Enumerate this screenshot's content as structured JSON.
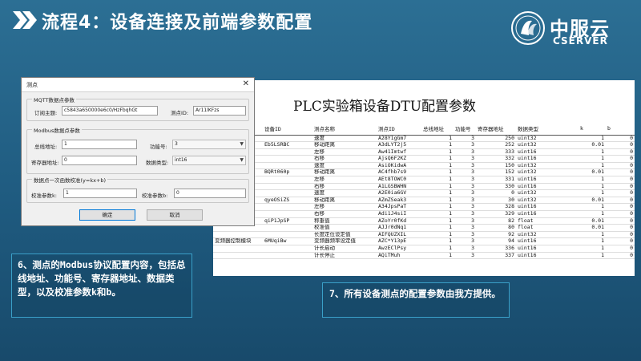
{
  "slide": {
    "title": "流程4：设备连接及前端参数配置",
    "logo_cn": "中服云",
    "logo_en": "CSERVER"
  },
  "dialog": {
    "title": "测点",
    "close_glyph": "✕",
    "mqtt_group": "MQTT数据点参数",
    "topic_label": "订阅主题:",
    "topic_value": "c5843a650000e6c0/HzFbqhGt",
    "point_id_label": "测点ID:",
    "point_id_value": "Ar11lKFzs",
    "modbus_group": "Modbus数据点参数",
    "bus_addr_label": "总线地址:",
    "bus_addr_value": "1",
    "func_label": "功能号:",
    "func_value": "3",
    "reg_addr_label": "寄存器地址:",
    "reg_addr_value": "0",
    "dtype_label": "数据类型:",
    "dtype_value": "int16",
    "calib_group": "数据点一次函数校准(y=kx+b)",
    "k_label": "校准参数k:",
    "k_value": "1",
    "b_label": "校准参数b:",
    "b_value": "0",
    "ok_label": "确定",
    "cancel_label": "取消"
  },
  "sheet": {
    "title": "PLC实验箱设备DTU配置参数",
    "headers": [
      "",
      "设备ID",
      "测点名称",
      "测点ID",
      "总线地址",
      "功能号",
      "寄存器地址",
      "数据类型",
      "k",
      "b"
    ],
    "rows": [
      [
        "",
        "",
        "速度",
        "A28Y1gGm7",
        "1",
        "3",
        "250",
        "uint32",
        "1",
        "0"
      ],
      [
        "机",
        "Eb5LSRBC",
        "移动距离",
        "A3dLYT2j5",
        "1",
        "3",
        "252",
        "uint32",
        "0.01",
        "0"
      ],
      [
        "",
        "",
        "左移",
        "Aw41Imtwf",
        "1",
        "3",
        "333",
        "uint16",
        "1",
        "0"
      ],
      [
        "",
        "",
        "右移",
        "AjsQ6F2KZ",
        "1",
        "3",
        "332",
        "uint16",
        "1",
        "0"
      ],
      [
        "",
        "",
        "速度",
        "AsiOKidwA",
        "1",
        "3",
        "150",
        "uint32",
        "1",
        "0"
      ],
      [
        "",
        "BQRt060p",
        "移动距离",
        "AC4fhb7s9",
        "1",
        "3",
        "152",
        "uint32",
        "0.01",
        "0"
      ],
      [
        "",
        "",
        "左移",
        "AEt8TOWC0",
        "1",
        "3",
        "331",
        "uint16",
        "1",
        "0"
      ],
      [
        "",
        "",
        "右移",
        "A1LGSBWHN",
        "1",
        "3",
        "330",
        "uint16",
        "1",
        "0"
      ],
      [
        "",
        "",
        "速度",
        "A2E0ia6GV",
        "1",
        "3",
        "0",
        "uint32",
        "1",
        "0"
      ],
      [
        "",
        "qyeOSiZS",
        "移动距离",
        "AZmZSeak3",
        "1",
        "3",
        "30",
        "uint32",
        "0.01",
        "0"
      ],
      [
        "",
        "",
        "左移",
        "A34JpsPaT",
        "1",
        "3",
        "328",
        "uint16",
        "1",
        "0"
      ],
      [
        "",
        "",
        "右移",
        "Adi1J4siI",
        "1",
        "3",
        "329",
        "uint16",
        "1",
        "0"
      ],
      [
        "称重模块",
        "qiP1JpSP",
        "称重值",
        "AZoYr0fKd",
        "1",
        "3",
        "82",
        "float",
        "0.01",
        "0"
      ],
      [
        "",
        "",
        "校准值",
        "AJJr0dNq1",
        "1",
        "3",
        "80",
        "float",
        "0.01",
        "0"
      ],
      [
        "",
        "",
        "长度定位设定值",
        "AIFQUZXIL",
        "1",
        "3",
        "92",
        "uint32",
        "1",
        "0"
      ],
      [
        "变频器控制模块",
        "6MUqiBw",
        "变频器频率设定值",
        "AZC*Y13pE",
        "1",
        "3",
        "94",
        "uint16",
        "1",
        "0"
      ],
      [
        "",
        "",
        "计长启动",
        "AwzEClPsy",
        "1",
        "3",
        "336",
        "uint16",
        "1",
        "0"
      ],
      [
        "",
        "",
        "计长停止",
        "AQiTMuh",
        "1",
        "3",
        "337",
        "uint16",
        "1",
        "0"
      ]
    ]
  },
  "callouts": {
    "left": "6、测点的Modbus协议配置内容，包括总线地址、功能号、寄存器地址、数据类型，以及校准参数k和b。",
    "right": "7、所有设备测点的配置参数由我方提供。"
  },
  "colors": {
    "background": "#1f5b80",
    "callout_border": "#3aa0c8"
  }
}
